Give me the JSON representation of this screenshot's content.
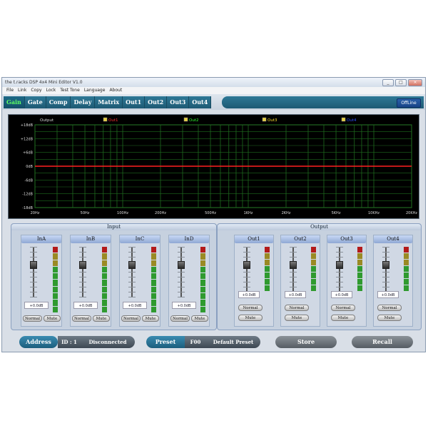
{
  "window": {
    "title": "the t.racks DSP 4x4 Mini Editor V1.0",
    "controls": [
      "_",
      "□",
      "×"
    ]
  },
  "menu": [
    "File",
    "Link",
    "Copy",
    "Lock",
    "Test Tone",
    "Language",
    "About"
  ],
  "tabs": [
    "Gain",
    "Gate",
    "Comp",
    "Delay",
    "Matrix",
    "Out1",
    "Out2",
    "Out3",
    "Out4"
  ],
  "active_tab": "Gain",
  "status": "OffLine",
  "graph": {
    "title": "Output",
    "legend": [
      {
        "name": "Out1",
        "color": "#ff3030"
      },
      {
        "name": "Out2",
        "color": "#30ff30"
      },
      {
        "name": "Out3",
        "color": "#ffe030"
      },
      {
        "name": "Out4",
        "color": "#3050ff"
      }
    ],
    "y_ticks": [
      "+18dB",
      "+12dB",
      "+6dB",
      "0dB",
      "-6dB",
      "-12dB",
      "-18dB"
    ],
    "x_ticks": [
      "20Hz",
      "50Hz",
      "100Hz",
      "200Hz",
      "500Hz",
      "1KHz",
      "2KHz",
      "5KHz",
      "10KHz",
      "20KHz"
    ],
    "response_db": 0
  },
  "input": {
    "label": "Input",
    "channels": [
      {
        "name": "InA",
        "value": "+0.0dB",
        "mode": "Normal",
        "mute": "Mute"
      },
      {
        "name": "InB",
        "value": "+0.0dB",
        "mode": "Normal",
        "mute": "Mute"
      },
      {
        "name": "InC",
        "value": "+0.0dB",
        "mode": "Normal",
        "mute": "Mute"
      },
      {
        "name": "InD",
        "value": "+0.0dB",
        "mode": "Normal",
        "mute": "Mute"
      }
    ]
  },
  "output": {
    "label": "Output",
    "channels": [
      {
        "name": "Out1",
        "value": "+0.0dB",
        "mode": "Normal",
        "mute": "Mute"
      },
      {
        "name": "Out2",
        "value": "+0.0dB",
        "mode": "Normal",
        "mute": "Mute"
      },
      {
        "name": "Out3",
        "value": "+0.0dB",
        "mode": "Normal",
        "mute": "Mute"
      },
      {
        "name": "Out4",
        "value": "+0.0dB",
        "mode": "Normal",
        "mute": "Mute"
      }
    ]
  },
  "bottom": {
    "address_label": "Address",
    "id_label": "ID : 1",
    "connection": "Disconnected",
    "preset_label": "Preset",
    "preset_value": "F00",
    "preset_name": "Default Preset",
    "store": "Store",
    "recall": "Recall"
  }
}
